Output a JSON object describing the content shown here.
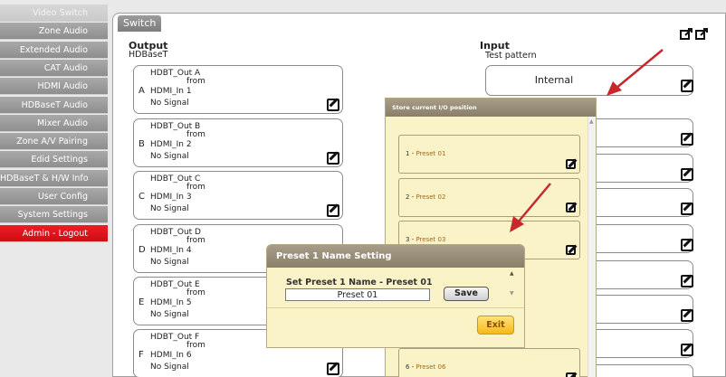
{
  "sidebar": {
    "items": [
      {
        "label": "Video Switch",
        "state": "faded"
      },
      {
        "label": "Zone Audio",
        "state": "normal"
      },
      {
        "label": "Extended Audio",
        "state": "normal"
      },
      {
        "label": "CAT Audio",
        "state": "normal"
      },
      {
        "label": "HDMI Audio",
        "state": "normal"
      },
      {
        "label": "HDBaseT Audio",
        "state": "normal"
      },
      {
        "label": "Mixer Audio",
        "state": "normal"
      },
      {
        "label": "Zone A/V Pairing",
        "state": "normal"
      },
      {
        "label": "Edid Settings",
        "state": "normal"
      },
      {
        "label": "HDBaseT & H/W Info",
        "state": "normal"
      },
      {
        "label": "User Config",
        "state": "normal"
      },
      {
        "label": "System Settings",
        "state": "normal"
      },
      {
        "label": "Admin - Logout",
        "state": "logout"
      }
    ]
  },
  "panel": {
    "tab_label": "Switch",
    "output": {
      "title": "Output",
      "subtitle": "HDBaseT",
      "rows": [
        {
          "letter": "A",
          "name": "HDBT_Out A",
          "from": "from",
          "source": "HDMI_In 1",
          "status": "No Signal"
        },
        {
          "letter": "B",
          "name": "HDBT_Out B",
          "from": "from",
          "source": "HDMI_In 2",
          "status": "No Signal"
        },
        {
          "letter": "C",
          "name": "HDBT_Out C",
          "from": "from",
          "source": "HDMI_In 3",
          "status": "No Signal"
        },
        {
          "letter": "D",
          "name": "HDBT_Out D",
          "from": "from",
          "source": "HDMI_In 4",
          "status": "No Signal"
        },
        {
          "letter": "E",
          "name": "HDBT_Out E",
          "from": "from",
          "source": "HDMI_In 5",
          "status": "No Signal"
        },
        {
          "letter": "F",
          "name": "HDBT_Out F",
          "from": "from",
          "source": "HDMI_In 6",
          "status": "No Signal"
        }
      ]
    },
    "input": {
      "title": "Input",
      "subtitle": "Test pattern",
      "first_value": "Internal"
    }
  },
  "store_panel": {
    "title": "Store current I/O position",
    "presets": [
      {
        "number": "1",
        "sep": " - ",
        "name": "Preset 01"
      },
      {
        "number": "2",
        "sep": " - ",
        "name": "Preset 02"
      },
      {
        "number": "3",
        "sep": " - ",
        "name": "Preset 03"
      },
      {
        "number": "6",
        "sep": " - ",
        "name": "Preset 06"
      }
    ]
  },
  "dialog": {
    "title": "Preset 1 Name Setting",
    "caption": "Set Preset 1 Name - Preset 01",
    "input_value": "Preset 01",
    "save_label": "Save",
    "exit_label": "Exit"
  },
  "colors": {
    "accent_red": "#ee1c25",
    "panel_yellow": "#fbf3c8",
    "header_brown": "#8a7f69",
    "arrow_red": "#c8282d",
    "exit_yellow": "#f5b918"
  },
  "icons": [
    "edit-icon",
    "popout-icon",
    "arrow-annotation",
    "scroll-up-icon",
    "scroll-down-icon"
  ]
}
